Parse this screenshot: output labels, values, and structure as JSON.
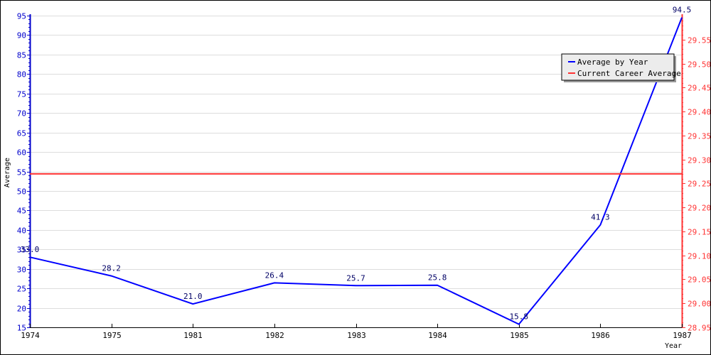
{
  "chart_data": {
    "type": "line",
    "title": "",
    "xlabel": "Year",
    "ylabel": "Average",
    "categories": [
      "1974",
      "1975",
      "1981",
      "1982",
      "1983",
      "1984",
      "1985",
      "1986",
      "1987"
    ],
    "series": [
      {
        "name": "Average by Year",
        "color": "#0000ff",
        "axis": "left",
        "values": [
          33.0,
          28.2,
          21.0,
          26.4,
          25.7,
          25.8,
          15.8,
          41.3,
          94.5
        ],
        "labels": [
          "33.0",
          "28.2",
          "21.0",
          "26.4",
          "25.7",
          "25.8",
          "15.8",
          "41.3",
          "94.5"
        ]
      },
      {
        "name": "Current Career Average",
        "color": "#ff3333",
        "axis": "right",
        "values": [
          29.27,
          29.27,
          29.27,
          29.27,
          29.27,
          29.27,
          29.27,
          29.27,
          29.27
        ]
      }
    ],
    "left_axis": {
      "ylim": [
        15,
        95
      ],
      "ticks": [
        15,
        20,
        25,
        30,
        35,
        40,
        45,
        50,
        55,
        60,
        65,
        70,
        75,
        80,
        85,
        90,
        95
      ],
      "color": "#0000cc"
    },
    "right_axis": {
      "ylim": [
        28.95,
        29.6
      ],
      "ticks": [
        "28.95",
        "29.00",
        "29.05",
        "29.10",
        "29.15",
        "29.20",
        "29.25",
        "29.30",
        "29.35",
        "29.40",
        "29.45",
        "29.50",
        "29.55"
      ],
      "color": "#ff3333"
    },
    "grid": true,
    "legend": {
      "position": "top-right",
      "entries": [
        "Average by Year",
        "Current Career Average"
      ]
    }
  }
}
